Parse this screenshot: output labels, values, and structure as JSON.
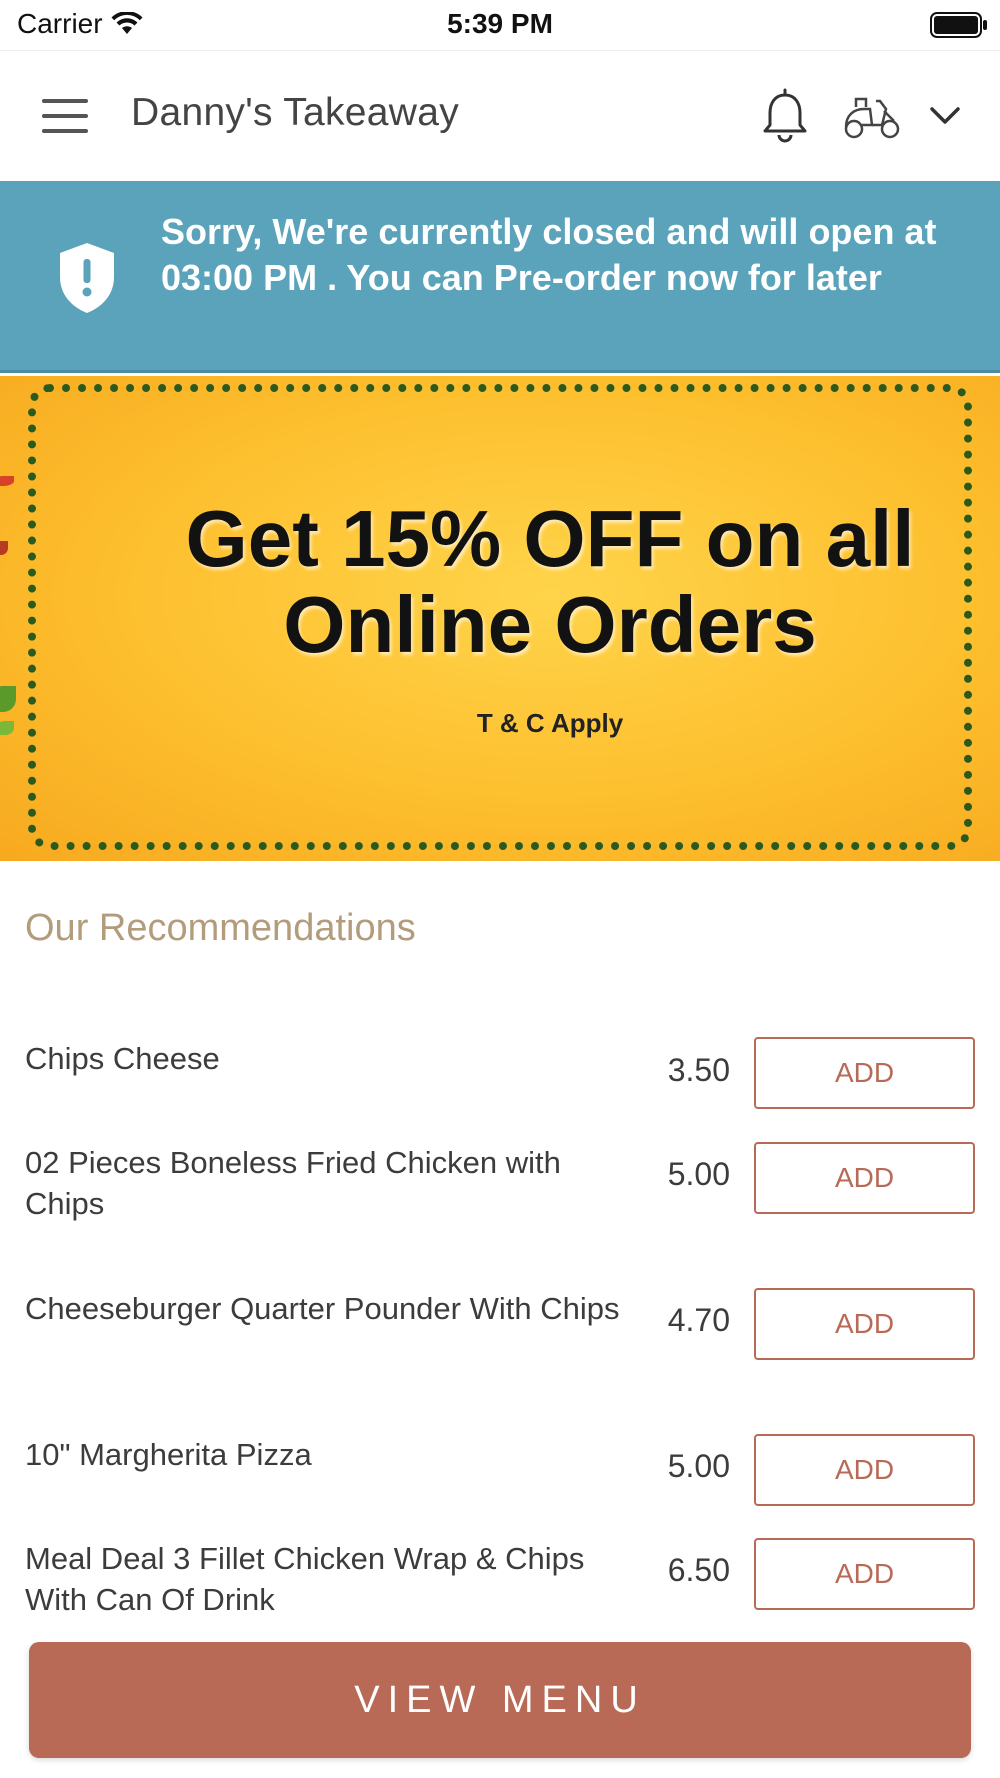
{
  "status_bar": {
    "carrier": "Carrier",
    "time": "5:39 PM"
  },
  "header": {
    "title": "Danny's Takeaway",
    "icons": [
      "menu-icon",
      "bell-icon",
      "scooter-icon",
      "chevron-down-icon"
    ]
  },
  "notice": {
    "text": "Sorry, We're currently closed and will open at 03:00 PM . You can Pre-order now for later",
    "icon": "shield-alert-icon",
    "background": "#5aa3ba"
  },
  "promo": {
    "headline": "Get 15% OFF on all Online Orders",
    "subtext": "T & C Apply",
    "background": "#fdbf2e"
  },
  "recommendations": {
    "title": "Our Recommendations",
    "add_label": "ADD",
    "items": [
      {
        "name": "Chips Cheese",
        "price": "3.50"
      },
      {
        "name": "02 Pieces Boneless Fried Chicken with Chips",
        "price": "5.00"
      },
      {
        "name": "Cheeseburger Quarter Pounder With Chips",
        "price": "4.70"
      },
      {
        "name": "10\" Margherita Pizza",
        "price": "5.00"
      },
      {
        "name": "Meal Deal 3 Fillet Chicken Wrap & Chips With Can Of Drink",
        "price": "6.50"
      }
    ]
  },
  "footer": {
    "view_menu_label": "VIEW MENU",
    "accent": "#b86a57"
  }
}
